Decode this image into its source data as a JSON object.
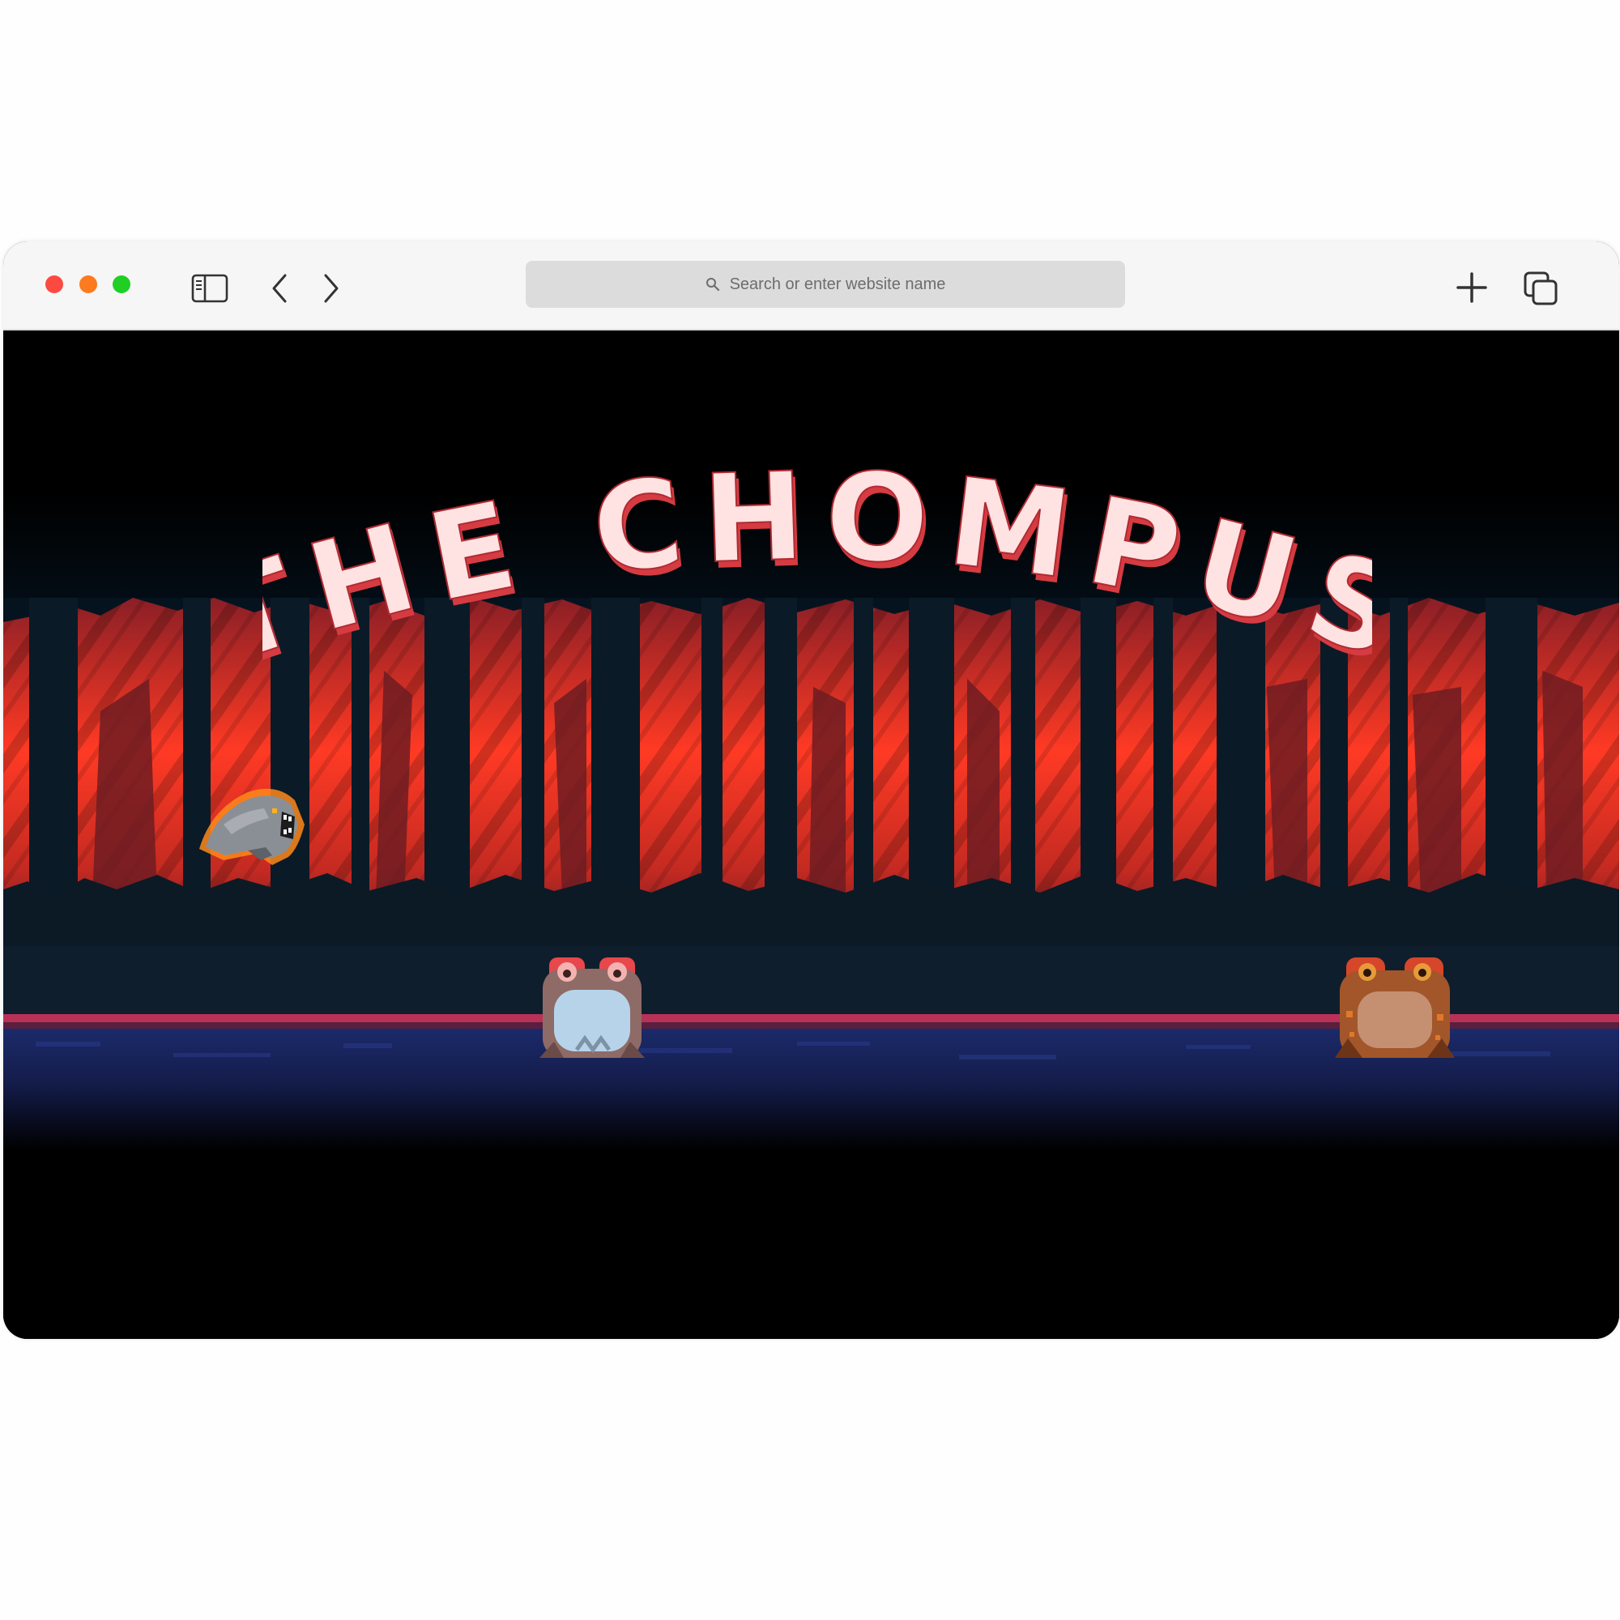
{
  "browser": {
    "address_placeholder": "Search or enter website name",
    "icons": {
      "close": "traffic-light-close",
      "minimize": "traffic-light-minimize",
      "zoom": "traffic-light-zoom",
      "sidebar": "sidebar-toggle-icon",
      "back": "chevron-left-icon",
      "forward": "chevron-right-icon",
      "search": "magnifier-icon",
      "new_tab": "plus-icon",
      "tabs": "tab-overview-icon"
    },
    "colors": {
      "close": "#fc4a42",
      "minimize": "#fd7a1f",
      "zoom": "#1fcf24"
    }
  },
  "game": {
    "title": "THE CHOMPUS",
    "colors": {
      "sky": "#05131f",
      "forest_glow": "#ff3a24",
      "forest_mid": "#c42a22",
      "forest_dark": "#6e1c22",
      "ground_edge": "#b83258",
      "ground": "#141c4a",
      "title_fill": "#ffe2e2",
      "title_shadow": "#d63b42"
    },
    "characters": [
      {
        "name": "chompus",
        "description": "grey beast leaping with orange glow"
      },
      {
        "name": "blue-frog"
      },
      {
        "name": "brown-toad"
      }
    ]
  }
}
